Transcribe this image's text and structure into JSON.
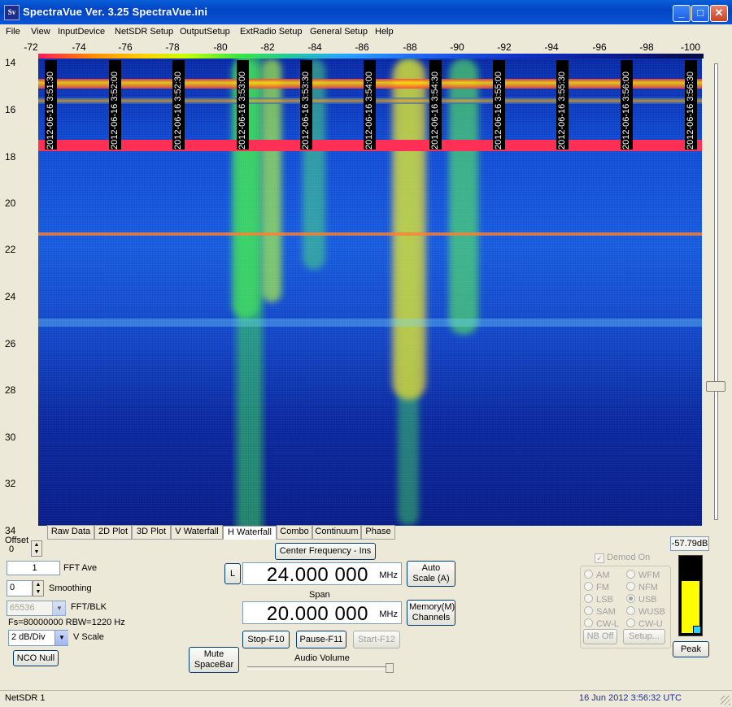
{
  "window": {
    "title": "SpectraVue Ver. 3.25  SpectraVue.ini",
    "app_icon": "Sv",
    "buttons": {
      "minimize": "_",
      "maximize": "□",
      "close": "✕"
    }
  },
  "menu": [
    "File",
    "View",
    "InputDevice",
    "NetSDR Setup",
    "OutputSetup",
    "ExtRadio Setup",
    "General Setup",
    "Help"
  ],
  "freq_axis": [
    "-72",
    "-74",
    "-76",
    "-78",
    "-80",
    "-82",
    "-84",
    "-86",
    "-88",
    "-90",
    "-92",
    "-94",
    "-96",
    "-98",
    "-100"
  ],
  "y_axis": [
    "14",
    "16",
    "18",
    "20",
    "22",
    "24",
    "26",
    "28",
    "30",
    "32",
    "34"
  ],
  "offset_label": "Offset",
  "timestamps": [
    "2012-06-16 3:51:30",
    "2012-06-16 3:52:00",
    "2012-06-16 3:52:30",
    "2012-06-16 3:53:00",
    "2012-06-16 3:53:30",
    "2012-06-16 3:54:00",
    "2012-06-16 3:54:30",
    "2012-06-16 3:55:00",
    "2012-06-16 3:55:30",
    "2012-06-16 3:56:00",
    "2012-06-16 3:56:30"
  ],
  "tabs": [
    "Raw Data",
    "2D Plot",
    "3D Plot",
    "V Waterfall",
    "H Waterfall",
    "Combo",
    "Continuum",
    "Phase"
  ],
  "active_tab": "H Waterfall",
  "controls": {
    "offset_value": "0",
    "fft_ave_value": "1",
    "fft_ave_label": "FFT Ave",
    "smoothing_value": "0",
    "smoothing_label": "Smoothing",
    "fft_blk_value": "65536",
    "fft_blk_label": "FFT/BLK",
    "fs_info": "Fs=80000000 RBW=1220 Hz",
    "vscale_value": "2 dB/Div",
    "vscale_label": "V Scale",
    "nco_null": "NCO Null",
    "mute": "Mute SpaceBar",
    "center_freq_button": "Center Frequency - Ins",
    "l_button": "L",
    "center_freq_value": "24.000 000",
    "center_freq_unit": "MHz",
    "span_label": "Span",
    "span_value": "20.000 000",
    "span_unit": "MHz",
    "auto_scale": "Auto Scale (A)",
    "memory": "Memory(M) Channels",
    "stop": "Stop-F10",
    "pause": "Pause-F11",
    "start": "Start-F12",
    "audio_volume_label": "Audio Volume",
    "audio_volume_level": 0.95
  },
  "demod": {
    "checkbox_label": "Demod On",
    "checked": true,
    "modes_left": [
      "AM",
      "FM",
      "LSB",
      "SAM",
      "CW-L"
    ],
    "modes_right": [
      "WFM",
      "NFM",
      "USB",
      "WUSB",
      "CW-U"
    ],
    "selected": "USB",
    "nb_off": "NB Off",
    "setup": "Setup..."
  },
  "meter": {
    "readout": "-57.79dB",
    "level": 0.7,
    "peak_button": "Peak"
  },
  "status": {
    "left": "NetSDR 1",
    "right": "16 Jun 2012  3:56:32 UTC"
  }
}
